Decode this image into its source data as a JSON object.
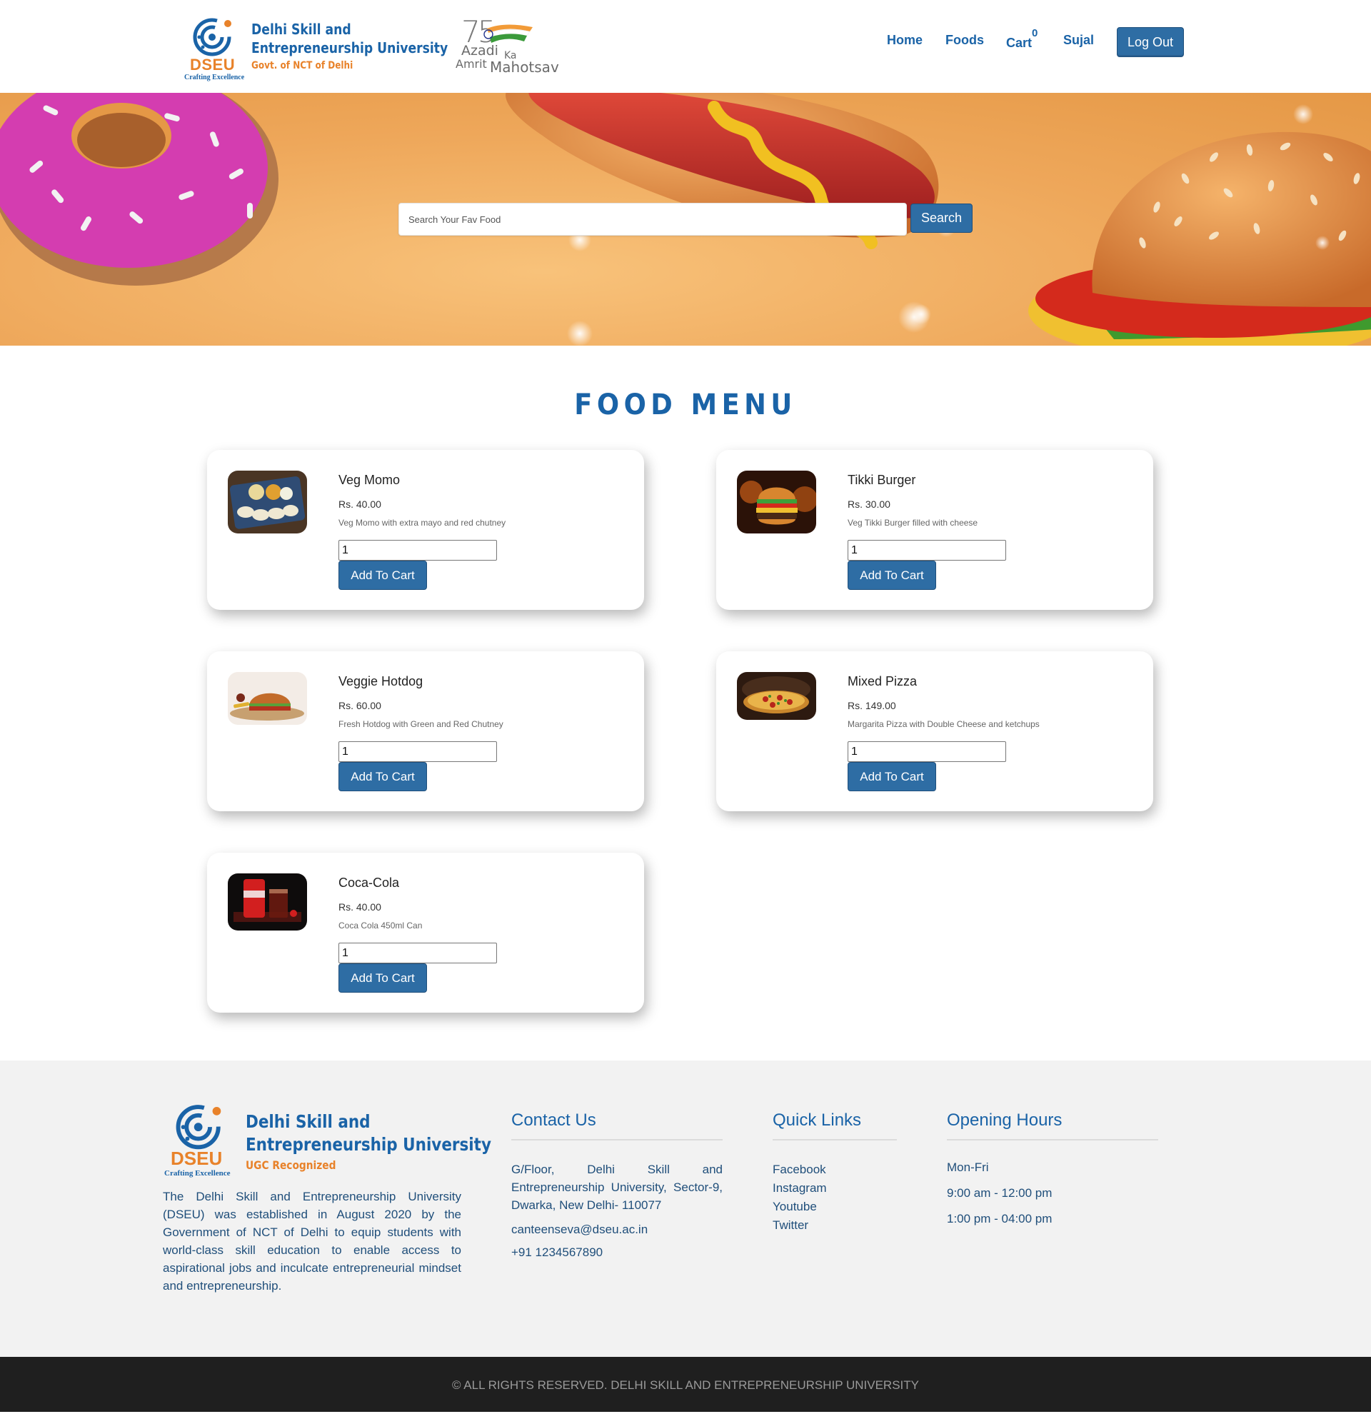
{
  "header": {
    "logo": {
      "abbr": "DSEU",
      "tagline": "Crafting Excellence",
      "title_line1": "Delhi Skill and",
      "title_line2": "Entrepreneurship University",
      "subtitle": "Govt. of NCT of Delhi"
    },
    "azadi": {
      "number": "75",
      "line1": "Azadi",
      "ka": "Ka",
      "line2a": "Amrit",
      "line2b": "Mahotsav"
    },
    "nav": {
      "home": "Home",
      "foods": "Foods",
      "cart": "Cart",
      "cart_count": "0",
      "user": "Sujal",
      "logout": "Log Out"
    }
  },
  "hero": {
    "search_placeholder": "Search Your Fav Food",
    "search_button": "Search"
  },
  "menu": {
    "title": "FOOD MENU",
    "add_label": "Add To Cart",
    "items": [
      {
        "name": "Veg Momo",
        "price": "Rs. 40.00",
        "desc": "Veg Momo with extra mayo and red chutney",
        "qty": "1",
        "image": "momo-photo"
      },
      {
        "name": "Tikki Burger",
        "price": "Rs. 30.00",
        "desc": "Veg Tikki Burger filled with cheese",
        "qty": "1",
        "image": "burger-photo"
      },
      {
        "name": "Veggie Hotdog",
        "price": "Rs. 60.00",
        "desc": "Fresh Hotdog with Green and Red Chutney",
        "qty": "1",
        "image": "hotdog-photo"
      },
      {
        "name": "Mixed Pizza",
        "price": "Rs. 149.00",
        "desc": "Margarita Pizza with Double Cheese and ketchups",
        "qty": "1",
        "image": "pizza-photo"
      },
      {
        "name": "Coca-Cola",
        "price": "Rs. 40.00",
        "desc": "Coca Cola 450ml Can",
        "qty": "1",
        "image": "cola-photo"
      }
    ]
  },
  "footer": {
    "logo": {
      "abbr": "DSEU",
      "tagline": "Crafting Excellence",
      "title_line1": "Delhi Skill and",
      "title_line2": "Entrepreneurship University",
      "subtitle": "UGC Recognized"
    },
    "about": "The Delhi Skill and Entrepreneurship University (DSEU) was established in August 2020 by the Government of NCT of Delhi to equip students with world-class skill education to enable access to aspirational jobs and inculcate entrepreneurial mindset and entrepreneurship.",
    "contact": {
      "heading": "Contact Us",
      "address": "G/Floor, Delhi Skill and Entrepreneurship University, Sector-9, Dwarka, New Delhi- 110077",
      "email": "canteenseva@dseu.ac.in",
      "phone": "+91 1234567890"
    },
    "links": {
      "heading": "Quick Links",
      "items": [
        "Facebook",
        "Instagram",
        "Youtube",
        "Twitter"
      ]
    },
    "hours": {
      "heading": "Opening Hours",
      "days": "Mon-Fri",
      "slot1": "9:00 am - 12:00 pm",
      "slot2": "1:00 pm - 04:00 pm"
    },
    "copyright": "© ALL RIGHTS RESERVED. DELHI SKILL AND ENTREPRENEURSHIP UNIVERSITY"
  },
  "colors": {
    "brand_blue": "#1a63a7",
    "brand_orange": "#e8822a",
    "button_blue": "#2e6da4",
    "footer_bg": "#f2f2f2",
    "copyright_bg": "#1f1f1f"
  }
}
